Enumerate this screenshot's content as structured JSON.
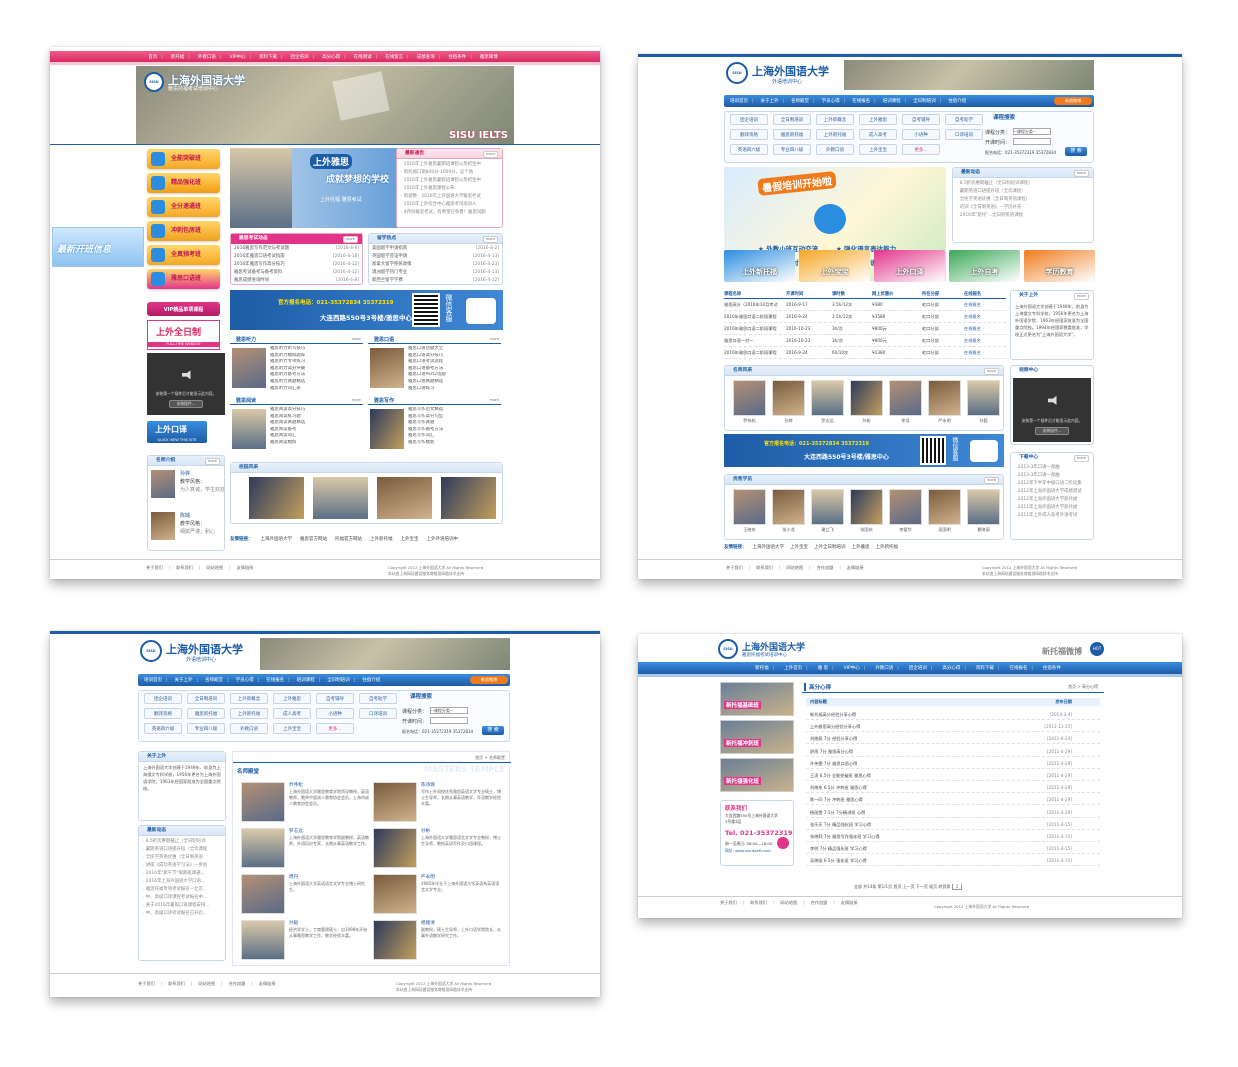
{
  "site": {
    "name": "上海外国语大学",
    "subtitle_train": "外语培训中心",
    "subtitle_ielts": "雅思托福考试培训中心",
    "copyright": "Copyright 2012 上海外国语大学 All Rights Reserved",
    "support": "本站由上海网站建设服务商推游网络技术支持",
    "crest": "SISU"
  },
  "colors": {
    "pink": "#e6386e",
    "blue": "#1d5ca6",
    "light": "#e8f1fb"
  },
  "s1": {
    "nav": [
      "首页",
      "新托福",
      "外教口语",
      "VIP中心",
      "资料下载",
      "团企培训",
      "高分心得",
      "在线测试",
      "在线留言",
      "成绩查询",
      "住宿条件",
      "雅思微博"
    ],
    "banner_title": "上海外国语大学",
    "banner_sub": "雅思托福考试培训中心",
    "banner_tag": "SISU IELTS",
    "left_buttons": [
      "全能突破班",
      "精品强化班",
      "全分速通班",
      "冲刺包房班",
      "全真预考班",
      "雅思口语班"
    ],
    "vip": "VIP精品单项课程",
    "quanri": "上外全日制",
    "quanri_en": "FULL-TIME WEBSITE",
    "video_text": "安装第一个插件后才能显示此内容。",
    "video_btn": "安装插件...",
    "koyi": "上外口译",
    "koyi_en": "QUICK VIEW THIS SITE",
    "float_banner": "最新开班信息",
    "teacher_title": "名师介绍",
    "teachers": [
      {
        "name": "孙骅",
        "desc": "教学风格：",
        "extra": "为人真诚，学生欢迎"
      },
      {
        "name": "陈璐",
        "desc": "教学风格：",
        "extra": "细腻严谨，耐心"
      }
    ],
    "hero_top": "上外雅思",
    "hero_line": "成就梦想的学校",
    "hero_extra": "上外托福 雅思考试",
    "notice_title": "最新通告",
    "notices": [
      "2016年上外雅思暑期班课程火热招生中",
      "新托福口语800分-1000分，这个地",
      "2016年上外雅思暑假班课程火热招生中",
      "2016年上外雅思课程公布",
      "新调整：2016年上外国语大学雅思考试",
      "2016年上外综合中心雅思考试培训人",
      "4月份雅思考试，有希望在免费！雅思试题"
    ],
    "exam_title": "雅思考试动态",
    "exam_items": [
      [
        "2016雅思写作范文与考试题",
        "2016-4-6"
      ],
      [
        "2016年雅思口语考试指南",
        "2016-4-18"
      ],
      [
        "2016年雅思写作高分技巧",
        "2016-4-12"
      ],
      [
        "雅思考试备考与备考资料",
        "2016-4-12"
      ],
      [
        "雅思成绩查询时间",
        "2016-4-8"
      ]
    ],
    "abroad_title": "留学热点",
    "abroad_items": [
      [
        "美国留学申请指南",
        "2016-4-2"
      ],
      [
        "英国留学签证申请",
        "2016-4-13"
      ],
      [
        "加拿大留学移民政策",
        "2016-4-23"
      ],
      [
        "澳洲留学热门专业",
        "2016-4-13"
      ],
      [
        "新西兰留学学费",
        "2016-4-12"
      ]
    ],
    "hotline": "官方报名电话：021-35372834 35372319",
    "address": "大连西路550号3号楼/雅思中心",
    "weixin": "微信客服",
    "sec_listen": "雅思听力",
    "sec_speak": "雅思口语",
    "sec_read": "雅思阅读",
    "sec_write": "雅思写作",
    "listen_items": [
      "雅思听力听写技巧",
      "雅思听力模拟题库",
      "雅思听力专项练习",
      "雅思听力高分突破",
      "雅思听力备考方法",
      "雅思听力真题精选",
      "雅思听力词汇表"
    ],
    "speak_items": [
      "雅思口语话题大全",
      "雅思口语高分技巧",
      "雅思口语考试流程",
      "雅思口语备考方法",
      "雅思口语Part2话题",
      "雅思口语真题精选",
      "雅思口语练习"
    ],
    "read_items": [
      "雅思阅读高分技巧",
      "雅思阅读练习题",
      "雅思阅读真题精选",
      "雅思阅读备考",
      "雅思阅读词汇",
      "雅思阅读模拟"
    ],
    "write_items": [
      "雅思写作范文精选",
      "雅思写作高分句型",
      "雅思写作真题",
      "雅思写作备考方法",
      "雅思写作词汇",
      "雅思写作模板"
    ],
    "campus": "校园风采",
    "links_label": "友情链接：",
    "links": [
      "上海外国语大学",
      "雅思官方网站",
      "托福官方网站",
      "上外新托福",
      "上外宝宝",
      "上外外语培训中"
    ],
    "footer": [
      "关于我们",
      "联系我们",
      "网站地图",
      "友情链接"
    ]
  },
  "s2": {
    "nav": [
      "培训首页",
      "关于上外",
      "名师殿堂",
      "学员心得",
      "在线报名",
      "培训课程",
      "全日制培训",
      "住宿介绍"
    ],
    "nav_right": "新浪微博",
    "courses": [
      "团企培训",
      "全日制培训",
      "上外新概念",
      "上外雅思",
      "自考辅导",
      "自考助学",
      "翻译资格",
      "雅思新托福",
      "上外新托福",
      "成人高考",
      "小语种",
      "口译培训",
      "英语四六级",
      "专业四八级",
      "外教口语",
      "上外宝宝",
      "更多..."
    ],
    "search_title": "课程搜索",
    "search_labels": [
      "课程分类：",
      "开课时间："
    ],
    "search_select": "--课程分类--",
    "search_btn": "搜 索",
    "phone": "报名电话：021-35372319 35372834",
    "promo": "暑假培训开始啦",
    "bullets": [
      "外教小班互动交流",
      "强化语言表达能力",
      "提高口语对话技巧",
      "学习纯正语音语调"
    ],
    "banner_tiles": [
      "上外新托福",
      "上外宝宝",
      "上外口译",
      "上外自考",
      "学历教育"
    ],
    "news_title": "最新动态",
    "news": [
      "8.5折优惠期截止（全日制培训课程）",
      "暑期英语口语提升班（全优课程）",
      "全民学英语优惠（全日制英语课程）",
      "培训《全日制英语》—学历补充",
      "2016年\"新托\"...全日制英语课程"
    ],
    "table_head": [
      "课程名称",
      "开课时间",
      "课时数",
      "网上优惠价",
      "所在分部",
      "在线报名"
    ],
    "table_rows": [
      [
        "雅思高分（2016年10月考试",
        "2016-9-17",
        "3.5h/12次",
        "¥380",
        "虹口分部",
        "在线报名"
      ],
      [
        "2016年雅思口语二阶段课程",
        "2016-9-24",
        "3.5h/12次",
        "¥3580",
        "虹口分部",
        "在线报名"
      ],
      [
        "2016年雅思口语二阶段课程",
        "2016-10-23",
        "3h/次",
        "¥800元",
        "虹口分部",
        "在线报名"
      ],
      [
        "雅思口语一对一",
        "2016-10-23",
        "3h/次",
        "¥800元",
        "虹口分部",
        "在线报名"
      ],
      [
        "2016年雅思口语二阶段课程",
        "2016-9-24",
        "6h/10次",
        "¥2380",
        "虹口分部",
        "在线报名"
      ]
    ],
    "about_title": "关于上外",
    "about_text": "上海外国语大学创建于1949年，前身为上海俄文专科学校，1956年更名为上海外国语学院，1963年经国家批准为全国重点院校。1994年经国家教委批准，学校正式更名为\"上海外国语大学\"。",
    "teachers_title": "名师风采",
    "teacher_names": [
      "乔伟松",
      "孙骅",
      "罗志远",
      "孙彬",
      "李月",
      "严永明",
      "孙毅"
    ],
    "video_title": "视频中心",
    "video_text": "安装第一个插件后才能显示此内容。",
    "video_btn": "安装插件...",
    "hotline": "官方报名电话：021-35372834 35372319",
    "address": "大连西路550号3号楼/雅思中心",
    "weixin": "微信客服",
    "students_title": "优秀学员",
    "student_names": [
      "王晓东",
      "张小龙",
      "谢立飞",
      "张国庆",
      "李爱华",
      "吴国明",
      "夏晓丽"
    ],
    "download_title": "下载中心",
    "downloads": [
      "2013-3年口语一部曲",
      "2013-3年口语一部曲",
      "2012年下半年中级口语二阶段集",
      "2012年上海外国语大学成绩测试",
      "2012年上海外国语大学新托福",
      "2011年上海外国语大学新托福",
      "2011年上外成人高考外语考试"
    ],
    "links_label": "友情链接：",
    "links": [
      "上海外国语大学",
      "上外宝宝",
      "上外全日制培训",
      "上外雅思",
      "上外新托福"
    ],
    "footer": [
      "关于我们",
      "联系我们",
      "网站地图",
      "合作加盟",
      "友情链接"
    ]
  },
  "s3": {
    "about_title": "关于上外",
    "about_text": "上海外国语大学创建于1949年，前身为上海俄文专科学校，1956年更名为上海外国语学院，1963年经国家批准为全国重点院校。",
    "news_title": "最新动态",
    "news": [
      "8.5折优惠期截止（全日制培训",
      "暑期英语口语提升班（全优课程",
      "全民学英语优惠（全日制英语",
      "讲座《成功英语学习法》—罗伯",
      "2016年\"新午节\"假期班课通...",
      "2016年上海外国语大学口语...",
      "雅思托福专项考试报名—北京...",
      "中、高级口译课程考试报名中...",
      "关于2016年暑假口语课程安排...",
      "中、高级口译考试报名已开启..."
    ],
    "crumb": "首页 > 名师殿堂",
    "main_title": "名师殿堂",
    "watermark": "MASTERS TEMPLE",
    "teachers": [
      {
        "name": "乔伟松",
        "desc": "上海外国语大学雅思教育学院资深教授，英语教师，教师中国成人教育协会会员，上海市成人教育协会会员。"
      },
      {
        "name": "陈诗璐",
        "desc": "写作上外同校优秀雅思英语文学专业硕士，博士生导师，长期从事英语教学，外语教学经验丰富。"
      },
      {
        "name": "罗志远",
        "desc": "上海外国语大学雅思教育学院副教授，英语教师，外语培训专家，长期从事英语教学工作。"
      },
      {
        "name": "孙彬",
        "desc": "上海外国语大学雅思语言文学专业教授，博士生导师，教授英语写作及口语课程。"
      },
      {
        "name": "周丹",
        "desc": "上海外国语大学英语语言文学专业博士研究生。"
      },
      {
        "name": "严永明",
        "desc": "1985年毕业于上海外国语大学英语系英语语言文学专业。"
      },
      {
        "name": "孙毅",
        "desc": "经济学学士，工商管理硕士，自1998年开始从事雅思教学工作，教学经验丰富。"
      },
      {
        "name": "杨顺清",
        "desc": "副教授，硕士生导师，上外口语学院院长，从事外语教学研究工作。"
      }
    ],
    "footer": [
      "关于我们",
      "联系我们",
      "网站地图",
      "合作加盟",
      "友情链接"
    ]
  },
  "s4": {
    "weibo": "新托福微博",
    "nav": [
      "新托福",
      "上外首页",
      "雅 思",
      "VIP中心",
      "外教口语",
      "团企培训",
      "高分心得",
      "资料下载",
      "在线报名",
      "住宿条件"
    ],
    "side_tiles": [
      "新托福基础班",
      "新托福冲刺班",
      "新托福强化班"
    ],
    "contact_title": "联系我们",
    "contact_lines": [
      "大连西路550号上海外国语大学",
      "3号楼3层"
    ],
    "tel": "Tel. 021-35372319",
    "contact_more": "周一至周日: 08:00—18:00",
    "web": "网址: www.sisutoefl.com",
    "section": "高分心得",
    "crumb": "首页 > 高分心得",
    "head": [
      "内容标题",
      "发布日期"
    ],
    "rows": [
      [
        "新托福高分经验分享心得",
        "2014-3-4"
      ],
      [
        "上外雅思高分经验分享心得",
        "2011-11-25"
      ],
      [
        "刘晓燕 7分 经验分享心得",
        "2011-6-24"
      ],
      [
        "舒雨 7分 雅思高分心得",
        "2011-4-29"
      ],
      [
        "孙伟雯 7分 雅思口语心得",
        "2011-4-29"
      ],
      [
        "王凌 6.5分 全能突破班 雅思心得",
        "2011-4-29"
      ],
      [
        "刘晓东 6.5分 冲刺班 雅思心得",
        "2011-4-29"
      ],
      [
        "陈一同 7分 冲刺班 雅思心得",
        "2011-4-29"
      ],
      [
        "杨丽雯 7.5分 7分精讲班 心得",
        "2011-4-29"
      ],
      [
        "张乐乐 7分 精品强化班 学习心得",
        "2011-4-15"
      ],
      [
        "朱晓莉 7分 雅思写作强化班 学习心得",
        "2011-4-15"
      ],
      [
        "李明 7分 精品强化班 学习心得",
        "2011-4-15"
      ],
      [
        "吴晓丽 6.5分 强化班 学习心得",
        "2011-4-15"
      ]
    ],
    "pager": "全部 共14条 第1/1页 首页 上一页 下一页 尾页 转到第",
    "pager_btn": "1",
    "footer": [
      "关于我们",
      "联系我们",
      "网站地图",
      "合作加盟",
      "友情链接"
    ]
  }
}
